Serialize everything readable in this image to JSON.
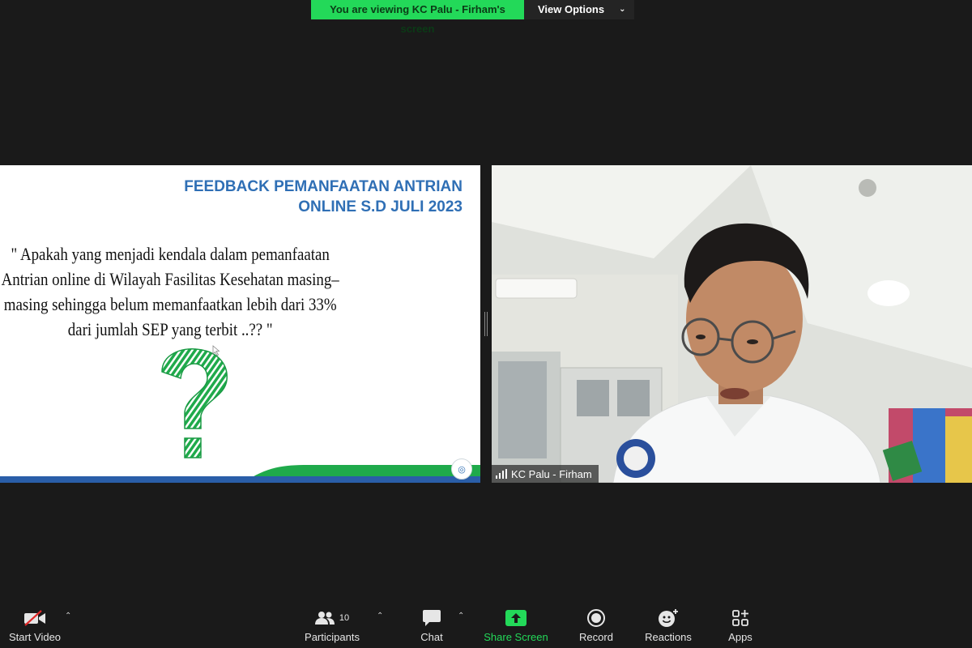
{
  "banner": {
    "viewing_text": "You are viewing KC Palu - Firham's screen",
    "view_options_label": "View Options"
  },
  "slide": {
    "title_line1": "FEEDBACK PEMANFAATAN ANTRIAN",
    "title_line2": "ONLINE S.D JULI 2023",
    "quote_lines": [
      "\" Apakah yang menjadi kendala dalam pemanfaatan",
      "Antrian online di Wilayah Fasilitas Kesehatan masing–",
      "masing sehingga belum memanfaatkan lebih dari 33%",
      "dari jumlah SEP yang terbit ..?? \""
    ],
    "colors": {
      "title": "#2f6fb5",
      "accent_green": "#1faa4b",
      "footer_blue": "#2a5ea8"
    }
  },
  "camera": {
    "participant_name": "KC Palu - Firham"
  },
  "toolbar": {
    "video_label": "Start Video",
    "participants_label": "Participants",
    "participants_count": "10",
    "chat_label": "Chat",
    "share_label": "Share Screen",
    "record_label": "Record",
    "reactions_label": "Reactions",
    "apps_label": "Apps",
    "share_color": "#23d959"
  }
}
